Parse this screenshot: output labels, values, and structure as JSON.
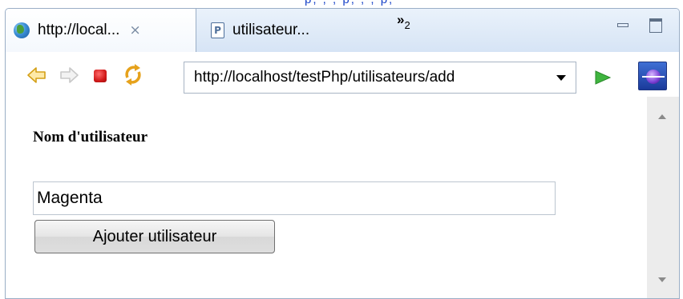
{
  "background_text": "p,   ,  ,   p,   ,  ,  p,",
  "tabs": [
    {
      "title": "http://local...",
      "close_glyph": "⨯",
      "icon": "globe-icon",
      "active": true
    },
    {
      "title": "utilisateur...",
      "icon_glyph": "P",
      "icon": "php-file-icon",
      "active": false
    }
  ],
  "tab_overflow": {
    "glyph": "»",
    "count": "2"
  },
  "toolbar": {
    "url": "http://localhost/testPhp/utilisateurs/add"
  },
  "form": {
    "label": "Nom d'utilisateur",
    "input_value": "Magenta",
    "submit_label": "Ajouter utilisateur"
  },
  "colors": {
    "tab_bar": "#d6e4f5",
    "stop": "#d11a1a",
    "go": "#3fb53f",
    "back_forward": "#f2c94c"
  }
}
